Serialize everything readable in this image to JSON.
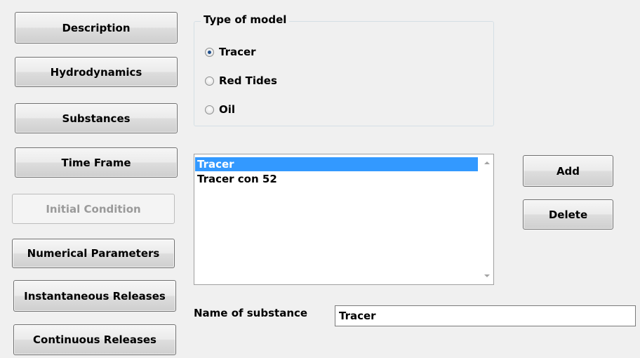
{
  "nav_buttons": [
    {
      "label": "Description",
      "enabled": true
    },
    {
      "label": "Hydrodynamics",
      "enabled": true
    },
    {
      "label": "Substances",
      "enabled": true
    },
    {
      "label": "Time Frame",
      "enabled": true
    },
    {
      "label": "Initial Condition",
      "enabled": false
    },
    {
      "label": "Numerical Parameters",
      "enabled": true
    },
    {
      "label": "Instantaneous Releases",
      "enabled": true
    },
    {
      "label": "Continuous Releases",
      "enabled": true
    }
  ],
  "model_type": {
    "legend": "Type of model",
    "options": [
      "Tracer",
      "Red Tides",
      "Oil"
    ],
    "selected": "Tracer"
  },
  "substances": {
    "items": [
      "Tracer",
      "Tracer con 52"
    ],
    "selected_index": 0
  },
  "actions": {
    "add_label": "Add",
    "delete_label": "Delete"
  },
  "name_field": {
    "label": "Name of substance",
    "value": "Tracer"
  },
  "colors": {
    "selection": "#3399ff",
    "window_bg": "#f0f0f0"
  }
}
